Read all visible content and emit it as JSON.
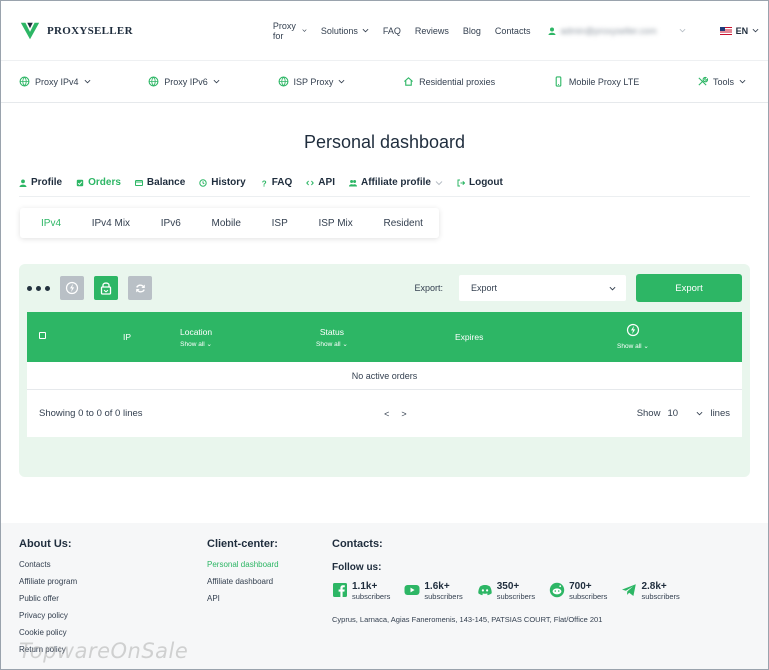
{
  "header": {
    "logo_text": "PROXYSELLER",
    "nav": [
      {
        "label": "Proxy for",
        "dropdown": true
      },
      {
        "label": "Solutions",
        "dropdown": true
      },
      {
        "label": "FAQ",
        "dropdown": false
      },
      {
        "label": "Reviews",
        "dropdown": false
      },
      {
        "label": "Blog",
        "dropdown": false
      },
      {
        "label": "Contacts",
        "dropdown": false
      }
    ],
    "account_email": "admin@proxyseller.com",
    "language": "EN"
  },
  "product_nav": [
    {
      "label": "Proxy IPv4",
      "icon": "globe-icon",
      "dropdown": true
    },
    {
      "label": "Proxy IPv6",
      "icon": "globe-icon",
      "dropdown": true
    },
    {
      "label": "ISP Proxy",
      "icon": "globe-icon",
      "dropdown": true
    },
    {
      "label": "Residential proxies",
      "icon": "house-icon",
      "dropdown": false
    },
    {
      "label": "Mobile Proxy LTE",
      "icon": "mobile-icon",
      "dropdown": false
    },
    {
      "label": "Tools",
      "icon": "tools-icon",
      "dropdown": true
    }
  ],
  "page_title": "Personal dashboard",
  "account_tabs": [
    {
      "label": "Profile",
      "active": false
    },
    {
      "label": "Orders",
      "active": true
    },
    {
      "label": "Balance",
      "active": false
    },
    {
      "label": "History",
      "active": false
    },
    {
      "label": "FAQ",
      "active": false
    },
    {
      "label": "API",
      "active": false
    },
    {
      "label": "Affiliate profile",
      "active": false
    },
    {
      "label": "Logout",
      "active": false
    }
  ],
  "proxy_tabs": [
    {
      "label": "IPv4",
      "active": true
    },
    {
      "label": "IPv4 Mix",
      "active": false
    },
    {
      "label": "IPv6",
      "active": false
    },
    {
      "label": "Mobile",
      "active": false
    },
    {
      "label": "ISP",
      "active": false
    },
    {
      "label": "ISP Mix",
      "active": false
    },
    {
      "label": "Resident",
      "active": false
    }
  ],
  "toolbar": {
    "export_label": "Export:",
    "export_select_value": "Export",
    "export_button": "Export"
  },
  "table": {
    "columns": {
      "ip": "IP",
      "location": "Location",
      "location_filter": "Show all",
      "status": "Status",
      "status_filter": "Show all",
      "expires": "Expires",
      "autorenew_filter": "Show all"
    },
    "empty_message": "No active orders",
    "showing_text": "Showing 0 to 0 of 0 lines",
    "prev": "<",
    "next": ">",
    "show_label": "Show",
    "page_size": "10",
    "lines_label": "lines"
  },
  "footer": {
    "about": {
      "title": "About Us:",
      "links": [
        "Contacts",
        "Affiliate program",
        "Public offer",
        "Privacy policy",
        "Cookie policy",
        "Return policy"
      ]
    },
    "client": {
      "title": "Client-center:",
      "links": [
        "Personal dashboard",
        "Affiliate dashboard",
        "API"
      ]
    },
    "contacts": {
      "title": "Contacts:",
      "follow_title": "Follow us:",
      "socials": [
        {
          "icon": "facebook-icon",
          "count": "1.1k+",
          "label": "subscribers"
        },
        {
          "icon": "youtube-icon",
          "count": "1.6k+",
          "label": "subscribers"
        },
        {
          "icon": "discord-icon",
          "count": "350+",
          "label": "subscribers"
        },
        {
          "icon": "reddit-icon",
          "count": "700+",
          "label": "subscribers"
        },
        {
          "icon": "telegram-icon",
          "count": "2.8k+",
          "label": "subscribers"
        }
      ],
      "address": "Cyprus, Larnaca, Agias Faneromenis, 143-145, PATSIAS COURT, Flat/Office 201"
    }
  },
  "watermark": "TopwareOnSale",
  "colors": {
    "accent": "#2db665",
    "panel": "#e9f6ed",
    "text": "#1f2d3d"
  }
}
